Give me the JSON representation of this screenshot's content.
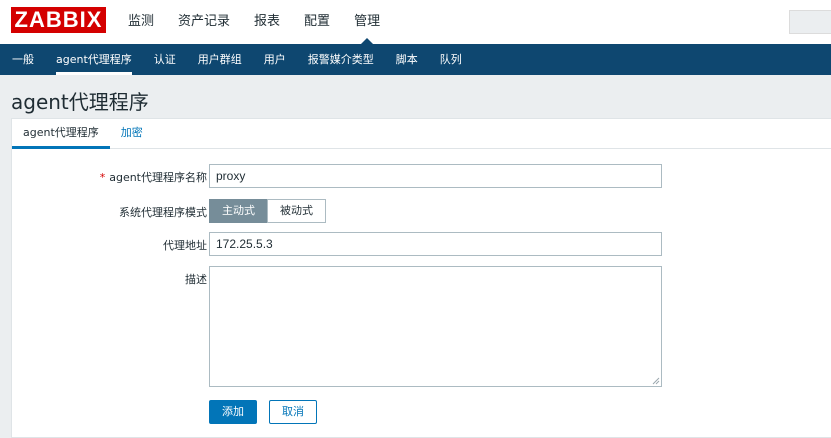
{
  "header": {
    "logo_text": "ZABBIX",
    "menu": [
      "监测",
      "资产记录",
      "报表",
      "配置",
      "管理"
    ],
    "active_menu": "管理"
  },
  "submenu": {
    "items": [
      "一般",
      "agent代理程序",
      "认证",
      "用户群组",
      "用户",
      "报警媒介类型",
      "脚本",
      "队列"
    ],
    "active": "agent代理程序"
  },
  "page": {
    "title": "agent代理程序"
  },
  "tabs": {
    "items": [
      "agent代理程序",
      "加密"
    ],
    "active": "agent代理程序"
  },
  "form": {
    "name_label": "agent代理程序名称",
    "name_required_mark": "*",
    "name_value": "proxy",
    "mode_label": "系统代理程序模式",
    "mode_options": [
      "主动式",
      "被动式"
    ],
    "mode_selected": "主动式",
    "address_label": "代理地址",
    "address_value": "172.25.5.3",
    "description_label": "描述",
    "description_value": "",
    "add_button": "添加",
    "cancel_button": "取消"
  },
  "colors": {
    "brand_red": "#d40000",
    "nav_blue": "#0e4770",
    "accent_blue": "#0275b8",
    "segment_selected": "#768d99"
  }
}
